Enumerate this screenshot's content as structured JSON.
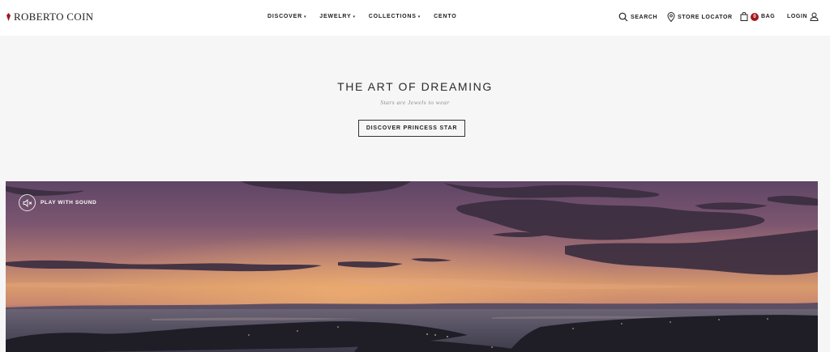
{
  "header": {
    "logo_text": "ROBERTO COIN",
    "nav": [
      {
        "label": "DISCOVER",
        "has_dropdown": true
      },
      {
        "label": "JEWELRY",
        "has_dropdown": true
      },
      {
        "label": "COLLECTIONS",
        "has_dropdown": true
      },
      {
        "label": "CENTO",
        "has_dropdown": false
      }
    ],
    "search_label": "SEARCH",
    "store_locator_label": "STORE LOCATOR",
    "bag_count": "0",
    "bag_label": "BAG",
    "login_label": "LOGIN"
  },
  "hero": {
    "title": "THE ART OF DREAMING",
    "subtitle": "Stars are Jewels to wear",
    "button_label": "DISCOVER PRINCESS STAR"
  },
  "video": {
    "sound_label": "PLAY WITH SOUND"
  },
  "colors": {
    "brand_red": "#a3171c",
    "text": "#222222",
    "page_bg": "#f6f6f6"
  },
  "icons": [
    "search-icon",
    "map-pin-icon",
    "bag-icon",
    "user-icon",
    "speaker-muted-icon",
    "logo-gem-icon"
  ]
}
